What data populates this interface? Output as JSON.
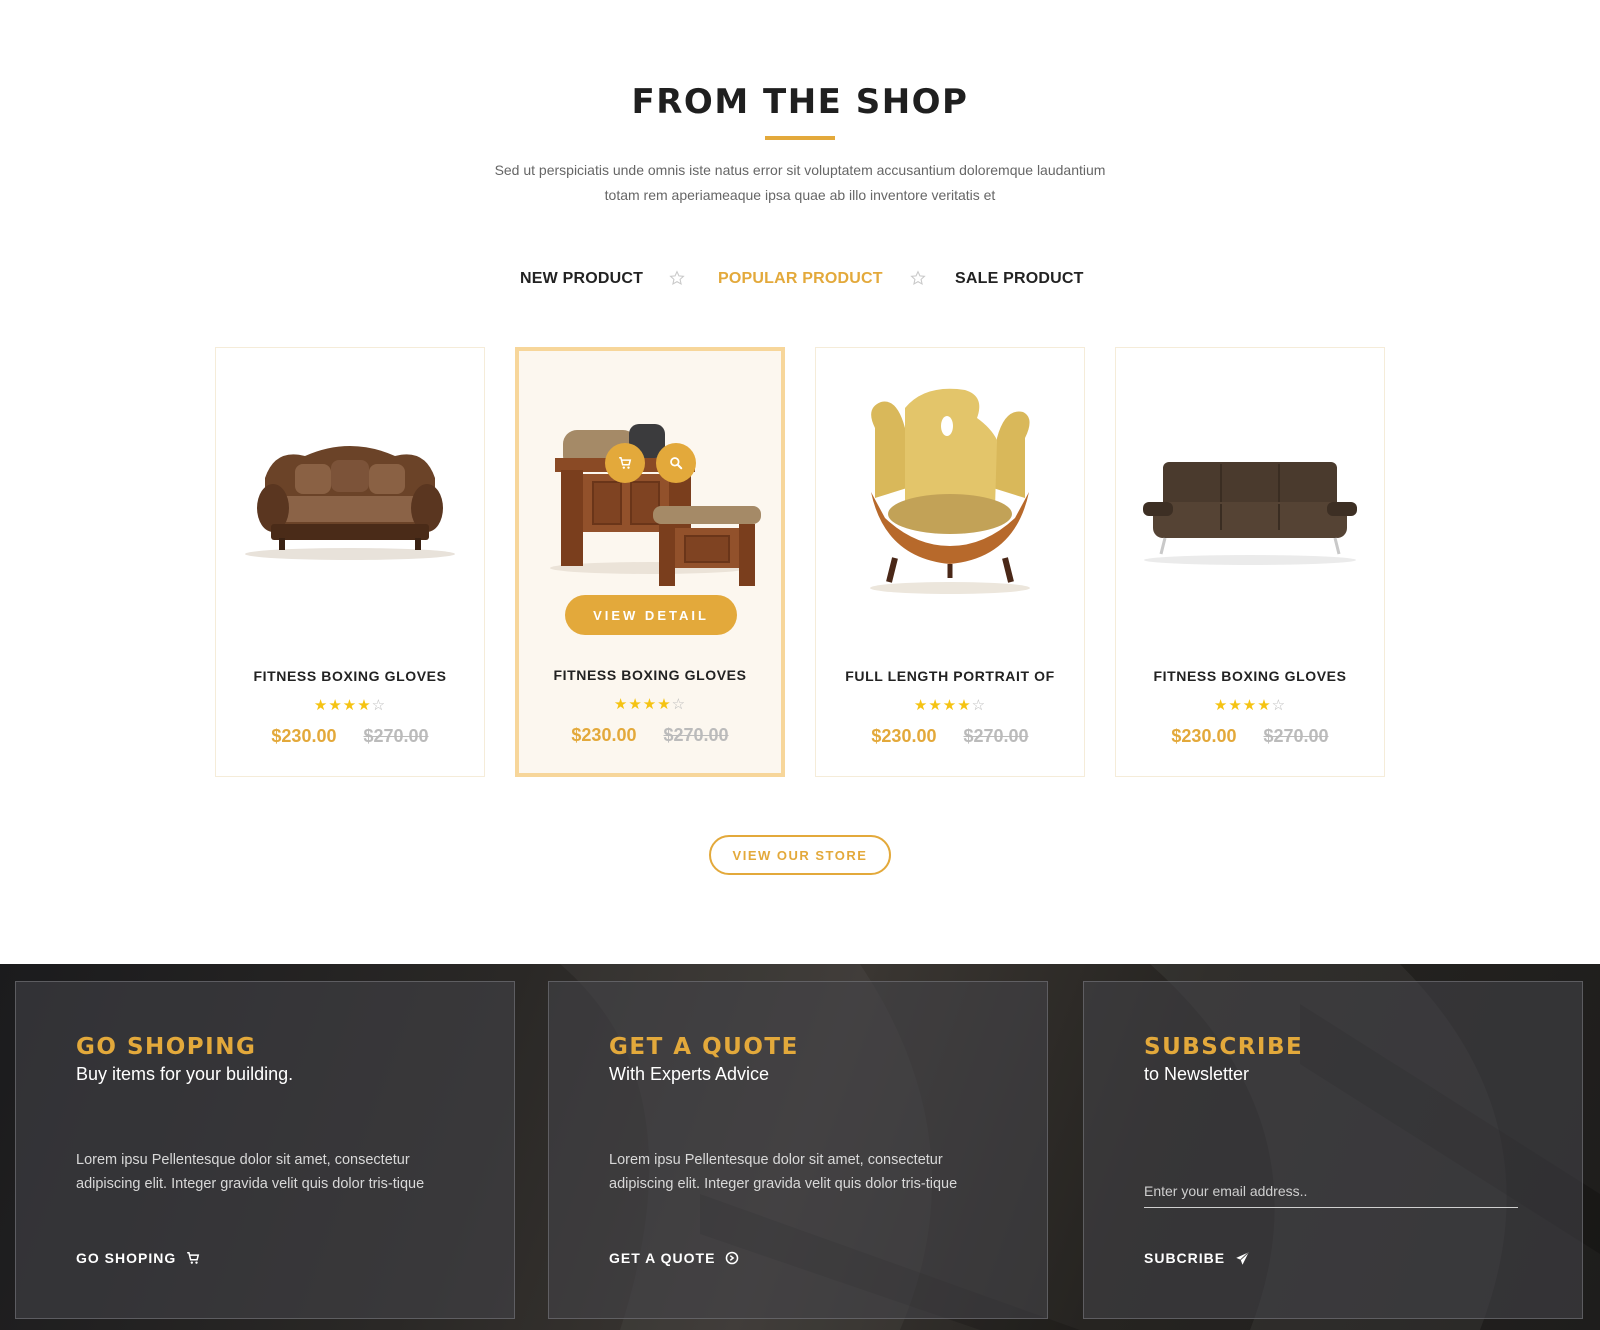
{
  "section": {
    "title": "FROM THE SHOP",
    "description_line1": "Sed ut perspiciatis unde omnis iste natus error sit voluptatem accusantium doloremque laudantium",
    "description_line2": "totam rem aperiameaque ipsa quae ab illo inventore veritatis et"
  },
  "tabs": [
    {
      "label": "NEW PRODUCT",
      "active": false
    },
    {
      "label": "POPULAR PRODUCT",
      "active": true
    },
    {
      "label": "SALE PRODUCT",
      "active": false
    }
  ],
  "products": [
    {
      "name": "FITNESS BOXING GLOVES",
      "rating": 4,
      "max_rating": 5,
      "price": "$230.00",
      "old_price": "$270.00",
      "image": "ornate-brown-sofa"
    },
    {
      "name": "FITNESS BOXING GLOVES",
      "rating": 4,
      "max_rating": 5,
      "price": "$230.00",
      "old_price": "$270.00",
      "image": "wooden-armchair-with-ottoman",
      "hovered": true
    },
    {
      "name": "FULL LENGTH PORTRAIT OF",
      "rating": 4,
      "max_rating": 5,
      "price": "$230.00",
      "old_price": "$270.00",
      "image": "yellow-designer-chair"
    },
    {
      "name": "FITNESS BOXING GLOVES",
      "rating": 4,
      "max_rating": 5,
      "price": "$230.00",
      "old_price": "$270.00",
      "image": "dark-leather-sofa"
    }
  ],
  "view_detail_label": "VIEW DETAIL",
  "view_store_label": "VIEW OUR STORE",
  "panels": {
    "shopping": {
      "title": "GO SHOPING",
      "subtitle": "Buy items for your building.",
      "body": "Lorem ipsu Pellentesque dolor sit amet, consectetur adipiscing elit. Integer gravida velit quis dolor tris-tique",
      "link": "GO SHOPING",
      "link_icon": "cart-icon"
    },
    "quote": {
      "title": "GET A QUOTE",
      "subtitle": "With Experts Advice",
      "body": "Lorem ipsu Pellentesque dolor sit amet, consectetur adipiscing elit. Integer gravida velit quis dolor tris-tique",
      "link": "GET A QUOTE",
      "link_icon": "arrow-circle-right-icon"
    },
    "subscribe": {
      "title": "SUBSCRIBE",
      "subtitle": "to Newsletter",
      "email_placeholder": "Enter your email address..",
      "link": "SUBCRIBE",
      "link_icon": "paper-plane-icon"
    }
  },
  "colors": {
    "accent": "#e3a93b",
    "star": "#f5c313",
    "old_price": "#bbbbbb",
    "footer_background": "#262421"
  }
}
